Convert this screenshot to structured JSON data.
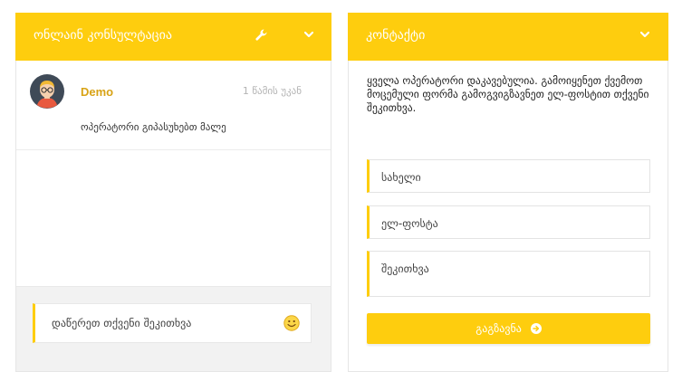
{
  "chat_panel": {
    "title": "ონლაინ კონსულტაცია",
    "icons": {
      "settings": "wrench-icon",
      "collapse": "chevron-down-icon"
    },
    "message": {
      "author": "Demo",
      "time": "1 წამის უკან",
      "text": "ოპერატორი გიპასუხებთ მალე",
      "avatar": "avatar-icon"
    },
    "input": {
      "placeholder": "დაწერეთ თქვენი შეკითხვა",
      "emoji": "smiley-icon"
    }
  },
  "contact_panel": {
    "title": "კონტაქტი",
    "notice": "ყველა ოპერატორი დაკავებულია. გამოიყენეთ ქვემოთ მოცემული ფორმა გამოგვიგზავნეთ ელ-ფოსტით თქვენი შეკითხვა.",
    "fields": {
      "name": "სახელი",
      "email": "ელ-ფოსტა",
      "question": "შეკითხვა"
    },
    "submit_label": "გაგზავნა",
    "icons": {
      "collapse": "chevron-down-icon",
      "submit": "arrow-circle-right-icon"
    }
  },
  "colors": {
    "accent": "#fecd0e",
    "author": "#d8a316",
    "footer_bg": "#f2f2f2"
  }
}
